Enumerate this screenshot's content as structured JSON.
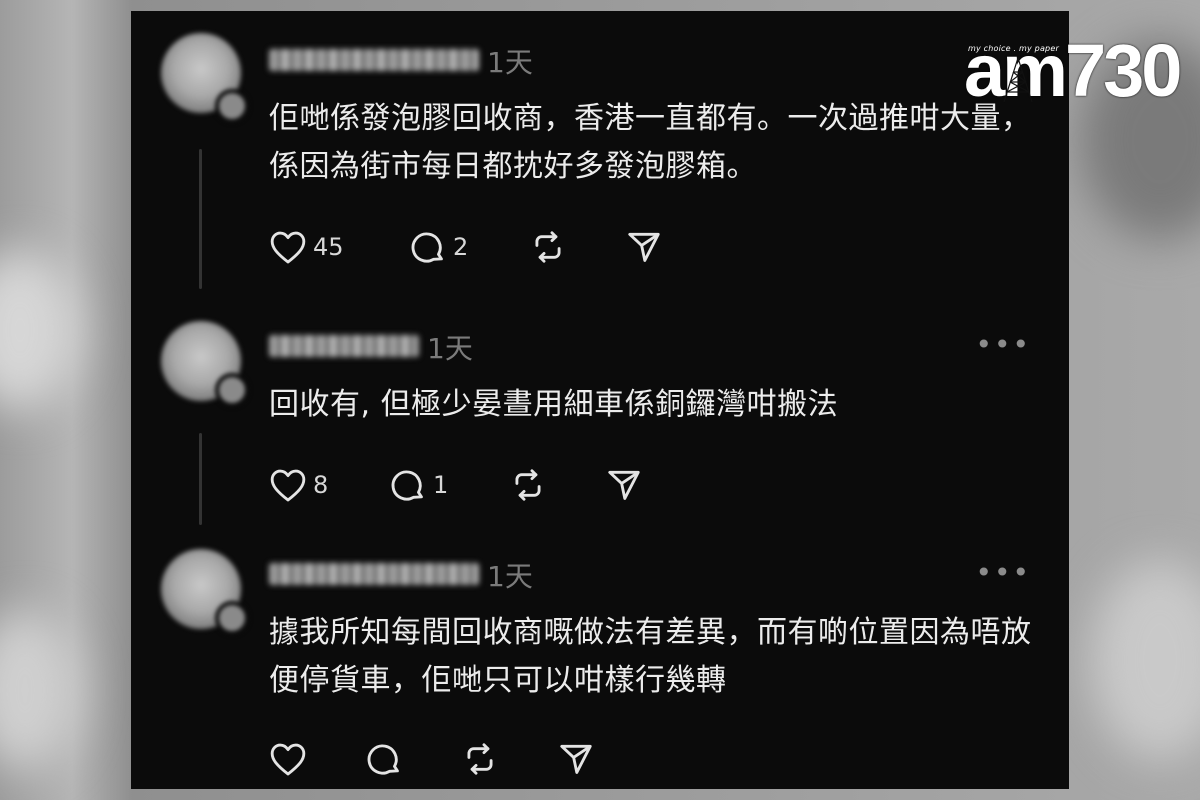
{
  "watermark": {
    "brand": "am730",
    "tagline": "my choice . my paper"
  },
  "posts": [
    {
      "time": "1天",
      "more_label": "•••",
      "text": "佢哋係發泡膠回收商，香港一直都有。一次過推咁大量，係因為街市每日都抌好多發泡膠箱。",
      "likes": "45",
      "replies": "2",
      "has_more": false
    },
    {
      "time": "1天",
      "more_label": "•••",
      "text": "回收有, 但極少晏晝用細車係銅鑼灣咁搬法",
      "likes": "8",
      "replies": "1",
      "has_more": true
    },
    {
      "time": "1天",
      "more_label": "•••",
      "text": "據我所知每間回收商嘅做法有差異，而有啲位置因為唔放便停貨車，佢哋只可以咁樣行幾轉",
      "likes": "",
      "replies": "",
      "has_more": true
    }
  ],
  "icons": [
    "heart-icon",
    "comment-icon",
    "repost-icon",
    "share-icon",
    "more-icon"
  ],
  "colors": {
    "panel": "#0b0b0b",
    "text": "#ececec",
    "muted": "#7b7b7b"
  }
}
